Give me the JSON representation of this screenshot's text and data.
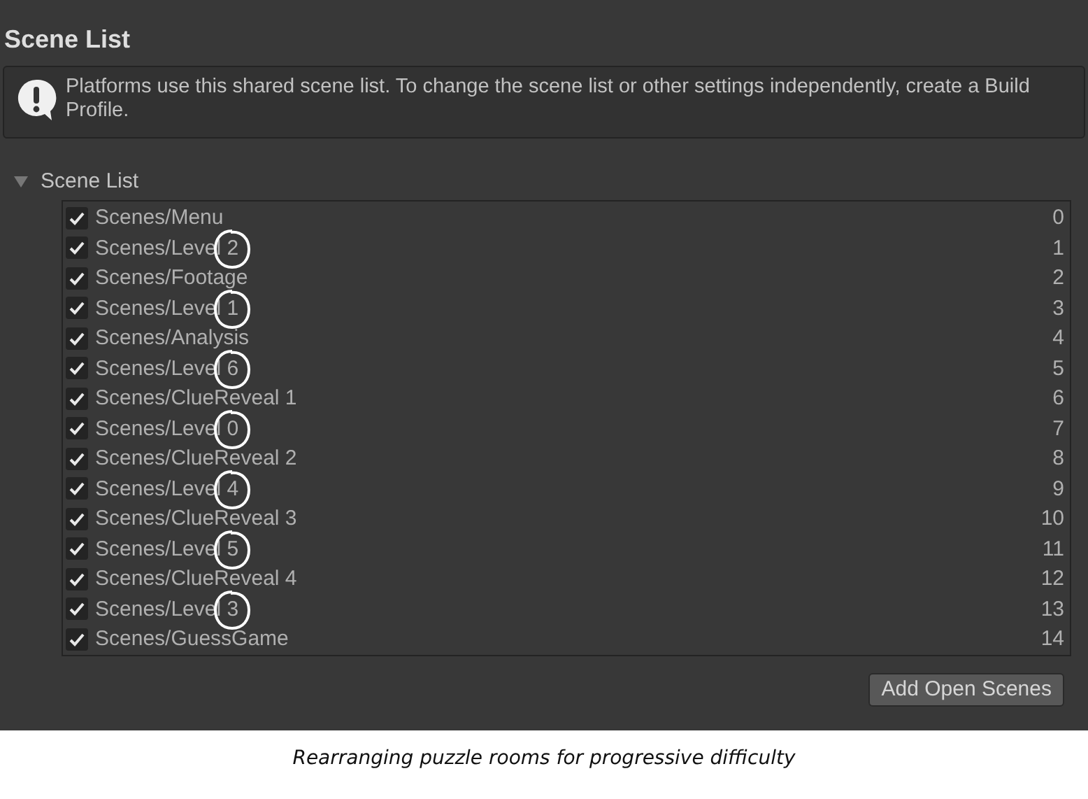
{
  "section_title": "Scene List",
  "help_box": {
    "kind": "info",
    "message": "Platforms use this shared scene list. To change the scene list or other settings independently, create a Build Profile."
  },
  "foldout": {
    "label": "Scene List",
    "expanded": true
  },
  "scenes": [
    {
      "name": "Scenes/Menu",
      "index": "0",
      "checked": true,
      "circled": false
    },
    {
      "name": "Scenes/Level 2",
      "index": "1",
      "checked": true,
      "circled": true
    },
    {
      "name": "Scenes/Footage",
      "index": "2",
      "checked": true,
      "circled": false
    },
    {
      "name": "Scenes/Level 1",
      "index": "3",
      "checked": true,
      "circled": true
    },
    {
      "name": "Scenes/Analysis",
      "index": "4",
      "checked": true,
      "circled": false
    },
    {
      "name": "Scenes/Level 6",
      "index": "5",
      "checked": true,
      "circled": true
    },
    {
      "name": "Scenes/ClueReveal 1",
      "index": "6",
      "checked": true,
      "circled": false
    },
    {
      "name": "Scenes/Level 0",
      "index": "7",
      "checked": true,
      "circled": true
    },
    {
      "name": "Scenes/ClueReveal 2",
      "index": "8",
      "checked": true,
      "circled": false
    },
    {
      "name": "Scenes/Level 4",
      "index": "9",
      "checked": true,
      "circled": true
    },
    {
      "name": "Scenes/ClueReveal 3",
      "index": "10",
      "checked": true,
      "circled": false
    },
    {
      "name": "Scenes/Level 5",
      "index": "11",
      "checked": true,
      "circled": true
    },
    {
      "name": "Scenes/ClueReveal 4",
      "index": "12",
      "checked": true,
      "circled": false
    },
    {
      "name": "Scenes/Level 3",
      "index": "13",
      "checked": true,
      "circled": true
    },
    {
      "name": "Scenes/GuessGame",
      "index": "14",
      "checked": true,
      "circled": false
    }
  ],
  "buttons": [
    "Add Open Scenes"
  ],
  "caption": "Rearranging puzzle rooms for progressive difficulty"
}
